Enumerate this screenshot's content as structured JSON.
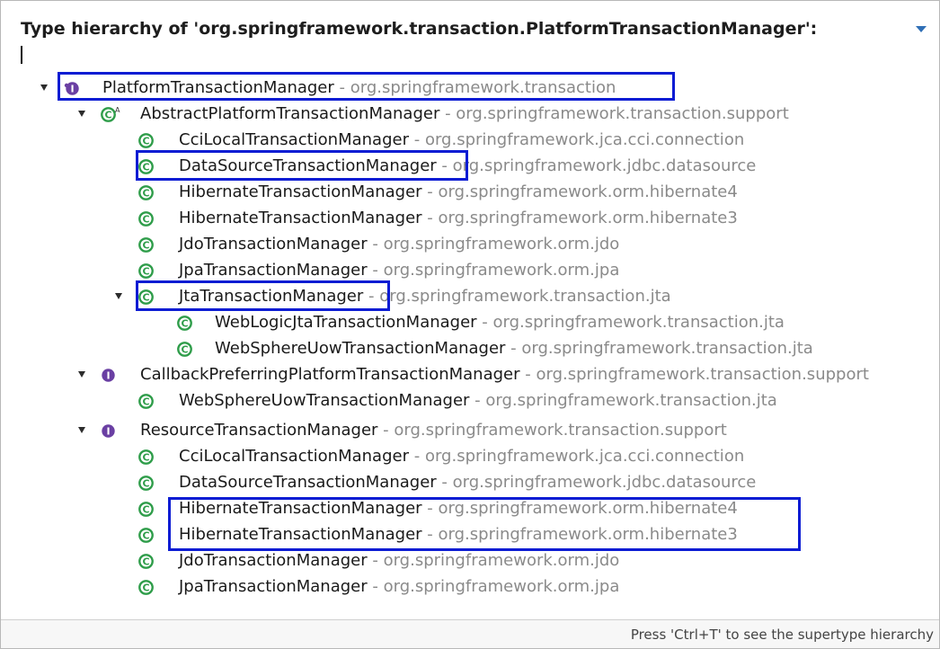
{
  "panel": {
    "title": "Type hierarchy of 'org.springframework.transaction.PlatformTransactionManager':",
    "filter_value": ""
  },
  "colors": {
    "class_icon": "#2f9d4a",
    "interface_icon": "#6a3fa3",
    "highlight_border": "#0b1cd3",
    "package_text": "#8a8a8a"
  },
  "tree": [
    {
      "kind": "interface-root",
      "name": "PlatformTransactionManager",
      "pkg": "org.springframework.transaction",
      "sep": " - ",
      "expanded": true,
      "highlight": true
    },
    {
      "kind": "abstract-class",
      "name": "AbstractPlatformTransactionManager",
      "pkg": "org.springframework.transaction.support",
      "sep": " - ",
      "expanded": true
    },
    {
      "kind": "class",
      "name": "CciLocalTransactionManager",
      "pkg": "org.springframework.jca.cci.connection",
      "sep": " - "
    },
    {
      "kind": "class",
      "name": "DataSourceTransactionManager",
      "pkg": "org.springframework.jdbc.datasource",
      "sep": " - ",
      "highlight": true
    },
    {
      "kind": "class",
      "name": "HibernateTransactionManager",
      "pkg": "org.springframework.orm.hibernate4",
      "sep": " - "
    },
    {
      "kind": "class",
      "name": "HibernateTransactionManager",
      "pkg": "org.springframework.orm.hibernate3",
      "sep": " - "
    },
    {
      "kind": "class",
      "name": "JdoTransactionManager",
      "pkg": "org.springframework.orm.jdo",
      "sep": " - "
    },
    {
      "kind": "class",
      "name": "JpaTransactionManager",
      "pkg": "org.springframework.orm.jpa",
      "sep": " - "
    },
    {
      "kind": "class",
      "name": "JtaTransactionManager",
      "pkg": "org.springframework.transaction.jta",
      "sep": " - ",
      "expanded": true,
      "highlight": true
    },
    {
      "kind": "class",
      "name": "WebLogicJtaTransactionManager",
      "pkg": "org.springframework.transaction.jta",
      "sep": " - "
    },
    {
      "kind": "class",
      "name": "WebSphereUowTransactionManager",
      "pkg": "org.springframework.transaction.jta",
      "sep": " - "
    },
    {
      "kind": "interface",
      "name": "CallbackPreferringPlatformTransactionManager",
      "pkg": "org.springframework.transaction.support",
      "sep": " - ",
      "expanded": true
    },
    {
      "kind": "class",
      "name": "WebSphereUowTransactionManager",
      "pkg": "org.springframework.transaction.jta",
      "sep": " - "
    },
    {
      "kind": "interface",
      "name": "ResourceTransactionManager",
      "pkg": "org.springframework.transaction.support",
      "sep": " - ",
      "expanded": true
    },
    {
      "kind": "class",
      "name": "CciLocalTransactionManager",
      "pkg": "org.springframework.jca.cci.connection",
      "sep": " - "
    },
    {
      "kind": "class",
      "name": "DataSourceTransactionManager",
      "pkg": "org.springframework.jdbc.datasource",
      "sep": " - "
    },
    {
      "kind": "class",
      "name": "HibernateTransactionManager",
      "pkg": "org.springframework.orm.hibernate4",
      "sep": " - ",
      "highlight_group": "hibernate"
    },
    {
      "kind": "class",
      "name": "HibernateTransactionManager",
      "pkg": "org.springframework.orm.hibernate3",
      "sep": " - ",
      "highlight_group": "hibernate"
    },
    {
      "kind": "class",
      "name": "JdoTransactionManager",
      "pkg": "org.springframework.orm.jdo",
      "sep": " - "
    },
    {
      "kind": "class",
      "name": "JpaTransactionManager",
      "pkg": "org.springframework.orm.jpa",
      "sep": " - "
    }
  ],
  "status": {
    "hint": "Press 'Ctrl+T' to see the supertype hierarchy"
  }
}
